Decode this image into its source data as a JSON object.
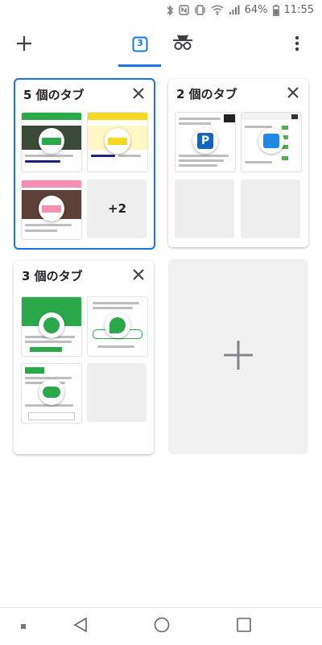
{
  "status": {
    "battery": "64%",
    "time": "11:55"
  },
  "toolbar": {
    "tab_count": "3",
    "icons": [
      "plus-icon",
      "tab-count-icon",
      "incognito-icon",
      "more-vert-icon"
    ]
  },
  "groups": [
    {
      "title": "5 個のタブ",
      "more": "+2",
      "selected": true
    },
    {
      "title": "2 個のタブ",
      "selected": false
    },
    {
      "title": "3 個のタブ",
      "selected": false
    }
  ],
  "colors": {
    "accent": "#1a73e8",
    "mineo_green": "#2aa84a",
    "yellow": "#f5d823",
    "pink": "#f48fb1"
  }
}
